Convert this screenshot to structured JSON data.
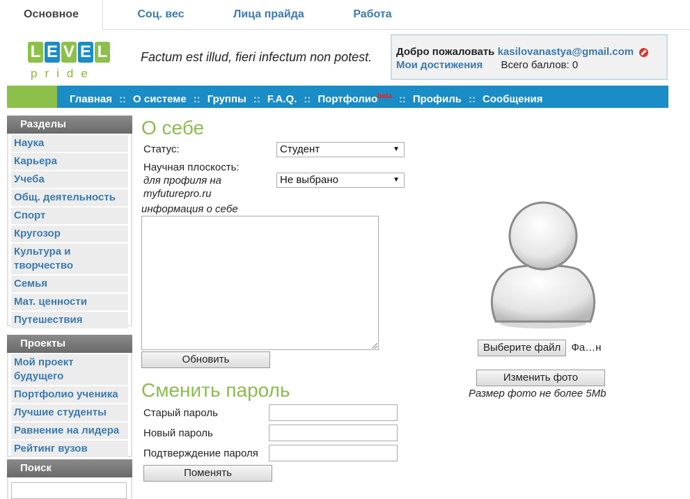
{
  "tabs": [
    {
      "label": "Основное"
    },
    {
      "label": "Соц. вес"
    },
    {
      "label": "Лица прайда"
    },
    {
      "label": "Работа"
    }
  ],
  "logo": {
    "letters": [
      "L",
      "E",
      "V",
      "E",
      "L"
    ],
    "colors": [
      "#8cc04b",
      "#1a8cc6",
      "#8cc04b",
      "#1a8cc6",
      "#8cc04b"
    ],
    "sub": "pride"
  },
  "motto": "Factum est illud, fieri infectum non potest.",
  "welcome": {
    "greeting": "Добро пожаловать",
    "email": "kasilovanastya@gmail.com",
    "achievements": "Мои достижения",
    "points": "Всего баллов: 0"
  },
  "nav": {
    "items": [
      "Главная",
      "О системе",
      "Группы",
      "F.A.Q.",
      "Портфолио",
      "Профиль",
      "Сообщения"
    ],
    "beta": "beta",
    "separator": "::"
  },
  "sidebar": {
    "sections_title": "Разделы",
    "sections": [
      "Наука",
      "Карьера",
      "Учеба",
      "Общ. деятельность",
      "Спорт",
      "Кругозор",
      "Культура и творчество",
      "Семья",
      "Мат. ценности",
      "Путешествия"
    ],
    "projects_title": "Проекты",
    "projects": [
      "Мой проект будущего",
      "Портфолио ученика",
      "Лучшие студенты",
      "Равнение на лидера",
      "Рейтинг вузов"
    ],
    "search_title": "Поиск"
  },
  "about": {
    "title": "О себе",
    "status_label": "Статус:",
    "status_value": "Студент",
    "plane_label": "Научная плоскость:",
    "plane_note": "для профиля на myfuturepro.ru",
    "plane_value": "Не выбрано",
    "info_label": "информация о себе",
    "update_button": "Обновить"
  },
  "password": {
    "title": "Сменить пароль",
    "old_label": "Старый пароль",
    "new_label": "Новый пароль",
    "confirm_label": "Подтверждение пароля",
    "change_button": "Поменять"
  },
  "photo": {
    "choose_button": "Выберите файл",
    "file_name": "Фа…н",
    "change_button": "Изменить фото",
    "size_note": "Размер фото не более 5Mb"
  }
}
